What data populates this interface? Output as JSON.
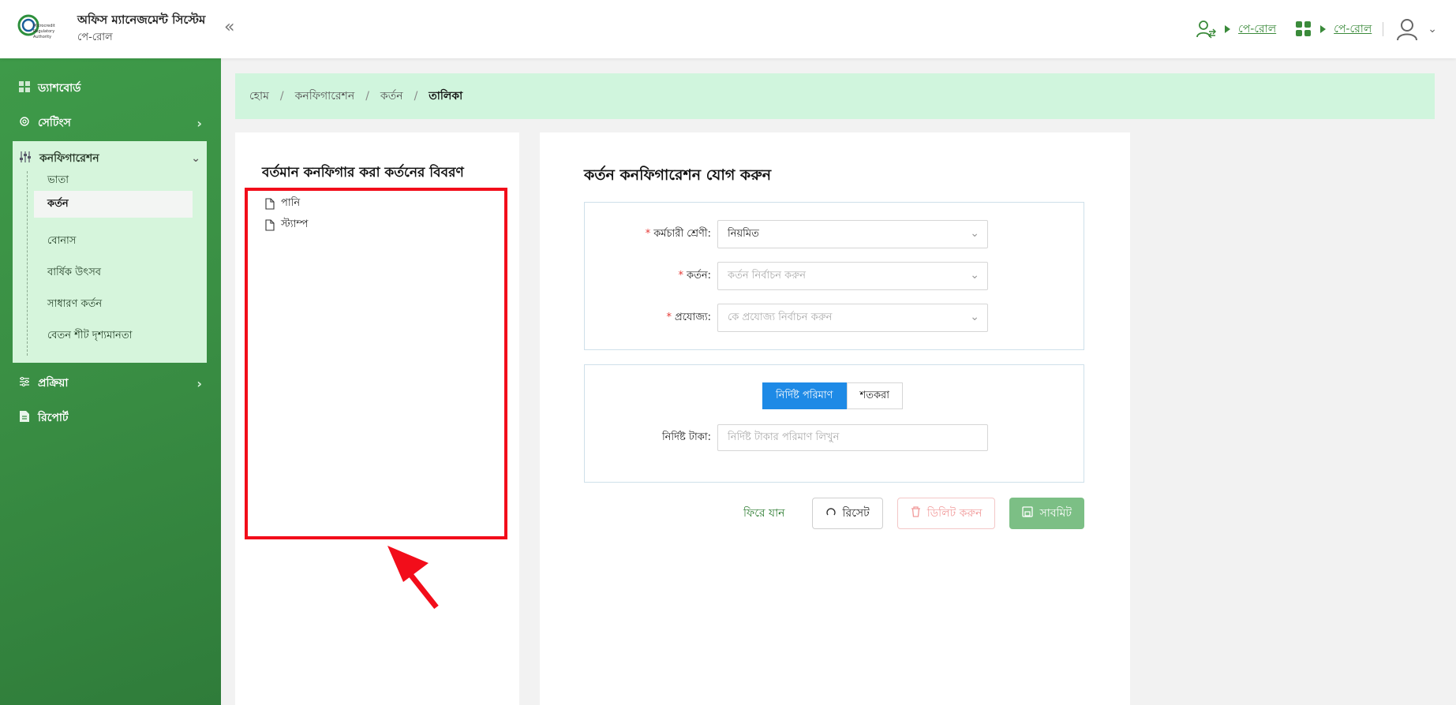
{
  "header": {
    "app_title": "অফিস ম্যানেজমেন্ট সিস্টেম",
    "app_subtitle": "পে-রোল",
    "logo_text": "Microcredit Regulatory Authority",
    "module_link_1": "পে-রোল",
    "module_link_2": "পে-রোল"
  },
  "sidebar": {
    "items": [
      {
        "label": "ড্যাশবোর্ড",
        "icon": "grid-icon"
      },
      {
        "label": "সেটিংস",
        "icon": "gear-icon"
      },
      {
        "label": "কনফিগারেশন",
        "icon": "sliders-icon"
      },
      {
        "label": "প্রক্রিয়া",
        "icon": "filter-icon"
      },
      {
        "label": "রিপোর্ট",
        "icon": "document-icon"
      }
    ],
    "config_children": [
      "ভাতা",
      "কর্তন",
      "বোনাস",
      "বার্ষিক উৎসব",
      "সাধারণ কর্তন",
      "বেতন শীট দৃশ্যমানতা"
    ]
  },
  "breadcrumb": [
    "হোম",
    "কনফিগারেশন",
    "কর্তন",
    "তালিকা"
  ],
  "left_panel": {
    "title": "বর্তমান কনফিগার করা কর্তনের বিবরণ",
    "tree": [
      "পানি",
      "স্ট্যাম্প"
    ]
  },
  "form": {
    "title": "কর্তন কনফিগারেশন যোগ করুন",
    "employee_class": {
      "label": "কর্মচারী শ্রেণী:",
      "value": "নিয়মিত"
    },
    "deduction": {
      "label": "কর্তন:",
      "placeholder": "কর্তন নির্বাচন করুন"
    },
    "applicable": {
      "label": "প্রযোজ্য:",
      "placeholder": "কে প্রযোজ্য নির্বাচন করুন"
    },
    "segment": {
      "fixed": "নির্দিষ্ট পরিমাণ",
      "percent": "শতকরা"
    },
    "fixed_amount": {
      "label": "নির্দিষ্ট টাকা:",
      "placeholder": "নির্দিষ্ট টাকার পরিমাণ লিখুন"
    },
    "buttons": {
      "back": "ফিরে যান",
      "reset": "রিসেট",
      "delete": "ডিলিট করুন",
      "submit": "সাবমিট"
    }
  },
  "colors": {
    "sidebar": "#3a8f44",
    "breadcrumb_bg": "#d0f5dd",
    "primary": "#1e8ae6",
    "highlight": "#f20d1a"
  }
}
